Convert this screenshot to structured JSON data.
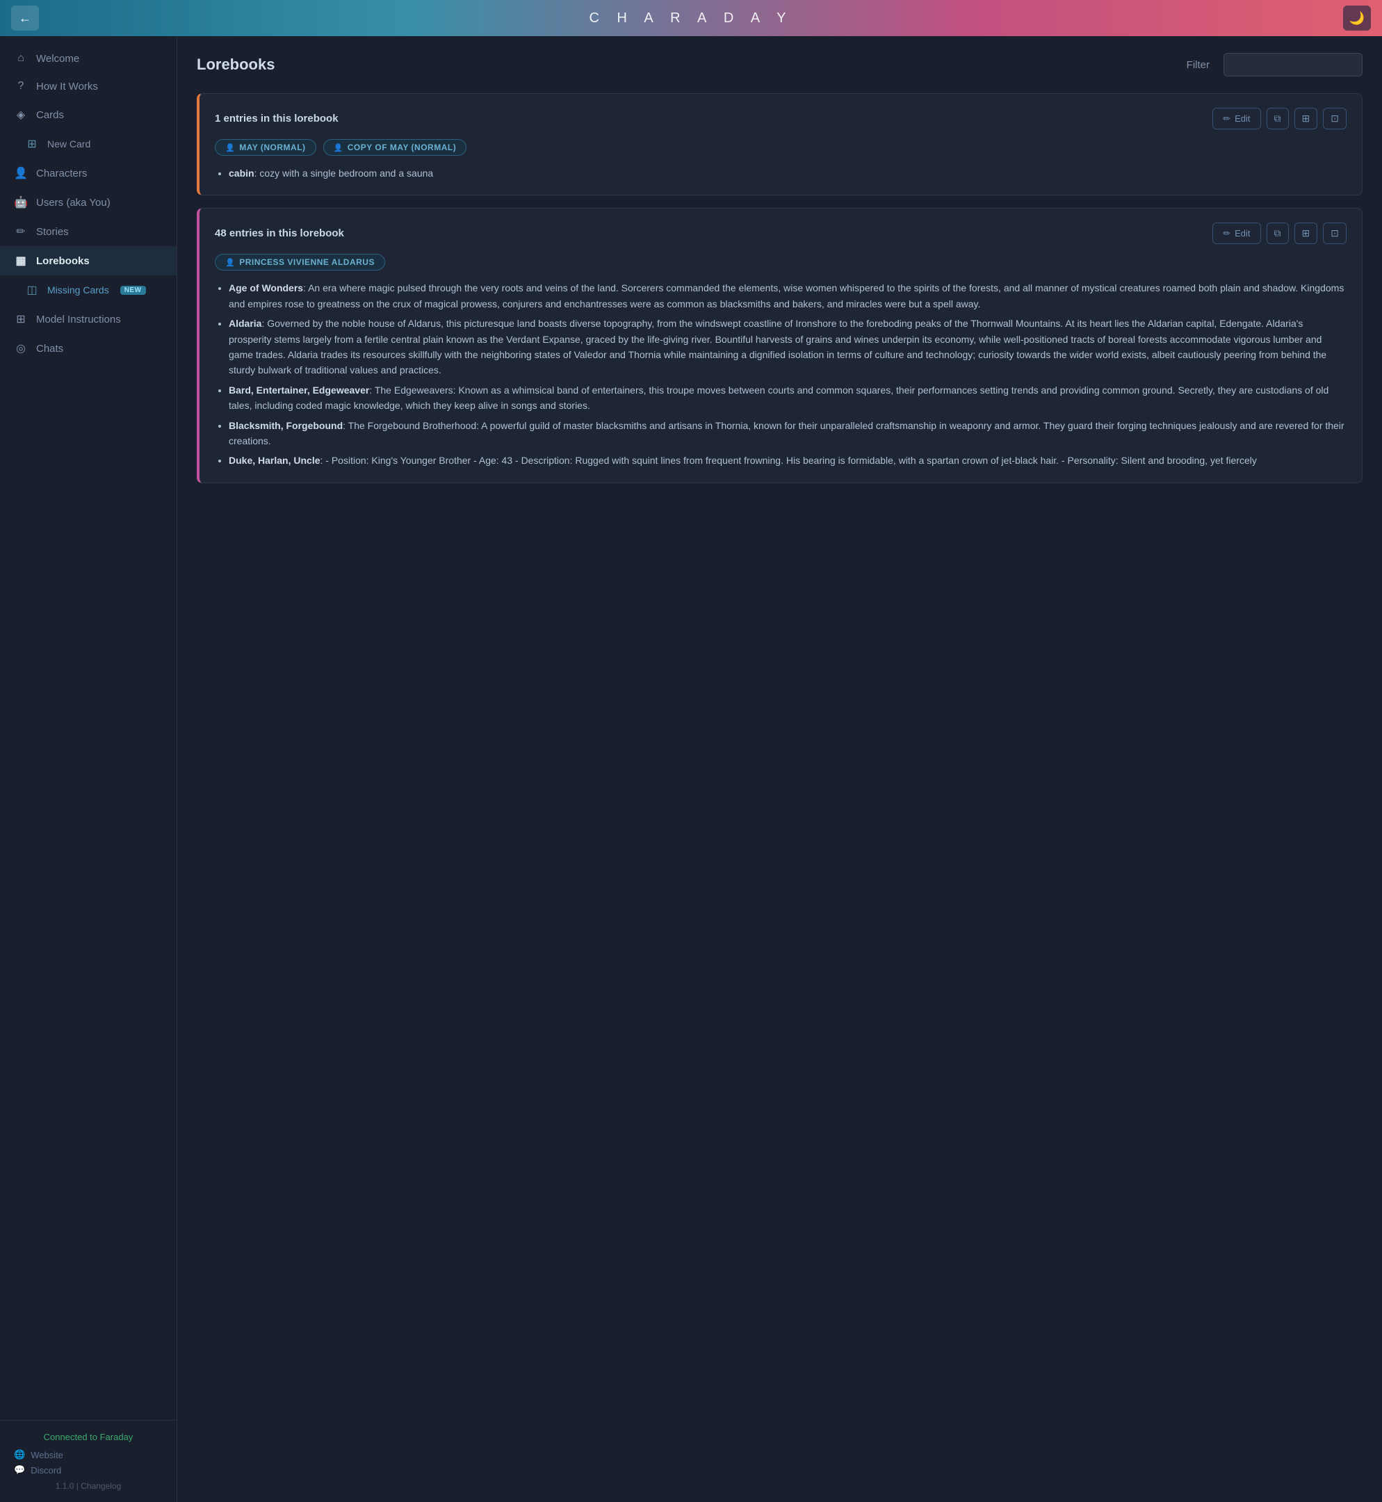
{
  "header": {
    "app_title": "C H A R A D A Y",
    "back_label": "←",
    "theme_icon": "🌙"
  },
  "sidebar": {
    "items": [
      {
        "id": "welcome",
        "label": "Welcome",
        "icon": "⌂",
        "active": false,
        "sub": false
      },
      {
        "id": "how-it-works",
        "label": "How It Works",
        "icon": "?",
        "active": false,
        "sub": false
      },
      {
        "id": "cards",
        "label": "Cards",
        "icon": "◈",
        "active": false,
        "sub": false
      },
      {
        "id": "new-card",
        "label": "New Card",
        "icon": "⊞",
        "active": false,
        "sub": true
      },
      {
        "id": "characters",
        "label": "Characters",
        "icon": "👤",
        "active": false,
        "sub": false
      },
      {
        "id": "users",
        "label": "Users (aka You)",
        "icon": "🤖",
        "active": false,
        "sub": false
      },
      {
        "id": "stories",
        "label": "Stories",
        "icon": "✏",
        "active": false,
        "sub": false
      },
      {
        "id": "lorebooks",
        "label": "Lorebooks",
        "icon": "▦",
        "active": true,
        "sub": false
      },
      {
        "id": "missing-cards",
        "label": "Missing Cards",
        "icon": "◫",
        "active": false,
        "sub": true,
        "badge": "NEW"
      },
      {
        "id": "model-instructions",
        "label": "Model Instructions",
        "icon": "⊞",
        "active": false,
        "sub": false
      },
      {
        "id": "chats",
        "label": "Chats",
        "icon": "◎",
        "active": false,
        "sub": false
      }
    ],
    "connected_label": "Connected to Faraday",
    "footer_links": [
      {
        "id": "website",
        "label": "Website",
        "icon": "🌐"
      },
      {
        "id": "discord",
        "label": "Discord",
        "icon": "💬"
      }
    ],
    "version": "1.1.0 | Changelog"
  },
  "content": {
    "page_title": "Lorebooks",
    "filter_label": "Filter",
    "filter_placeholder": "",
    "lorebooks": [
      {
        "id": "lorebook-1",
        "entries_count": "1 entries in this lorebook",
        "border_color": "#e07840",
        "tags": [
          {
            "label": "MAY (NORMAL)",
            "icon": "👤"
          },
          {
            "label": "COPY OF MAY (NORMAL)",
            "icon": "👤"
          }
        ],
        "entries": [
          {
            "key": "cabin",
            "value": "cozy with a single bedroom and a sauna"
          }
        ]
      },
      {
        "id": "lorebook-2",
        "entries_count": "48 entries in this lorebook",
        "border_color": "#c050a0",
        "tags": [
          {
            "label": "PRINCESS VIVIENNE ALDARUS",
            "icon": "👤"
          }
        ],
        "entries": [
          {
            "key": "Age of Wonders",
            "value": "An era where magic pulsed through the very roots and veins of the land. Sorcerers commanded the elements, wise women whispered to the spirits of the forests, and all manner of mystical creatures roamed both plain and shadow. Kingdoms and empires rose to greatness on the crux of magical prowess, conjurers and enchantresses were as common as blacksmiths and bakers, and miracles were but a spell away."
          },
          {
            "key": "Aldaria",
            "value": "Governed by the noble house of Aldarus, this picturesque land boasts diverse topography, from the windswept coastline of Ironshore to the foreboding peaks of the Thornwall Mountains. At its heart lies the Aldarian capital, Edengate. Aldaria's prosperity stems largely from a fertile central plain known as the Verdant Expanse, graced by the life-giving river. Bountiful harvests of grains and wines underpin its economy, while well-positioned tracts of boreal forests accommodate vigorous lumber and game trades. Aldaria trades its resources skillfully with the neighboring states of Valedor and Thornia while maintaining a dignified isolation in terms of culture and technology; curiosity towards the wider world exists, albeit cautiously peering from behind the sturdy bulwark of traditional values and practices."
          },
          {
            "key": "Bard, Entertainer, Edgeweaver",
            "value": "The Edgeweavers: Known as a whimsical band of entertainers, this troupe moves between courts and common squares, their performances setting trends and providing common ground. Secretly, they are custodians of old tales, including coded magic knowledge, which they keep alive in songs and stories."
          },
          {
            "key": "Blacksmith, Forgebound",
            "value": "The Forgebound Brotherhood: A powerful guild of master blacksmiths and artisans in Thornia, known for their unparalleled craftsmanship in weaponry and armor. They guard their forging techniques jealously and are revered for their creations."
          },
          {
            "key": "Duke, Harlan, Uncle",
            "value": "- Position: King's Younger Brother - Age: 43 - Description: Rugged with squint lines from frequent frowning. His bearing is formidable, with a spartan crown of jet-black hair. - Personality: Silent and brooding, yet fiercely"
          }
        ]
      }
    ],
    "edit_label": "Edit",
    "copy_icon": "⧉",
    "action_icon_1": "⊞",
    "action_icon_2": "⊡"
  }
}
